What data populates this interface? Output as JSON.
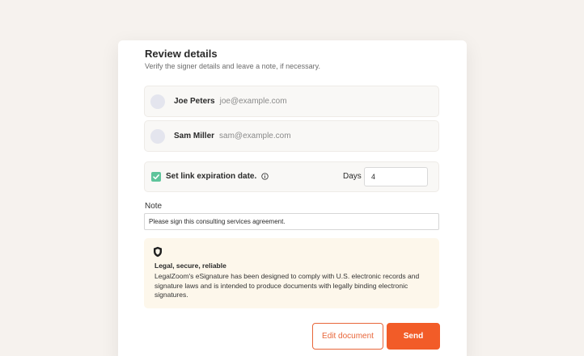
{
  "header": {
    "title": "Review details",
    "subtitle": "Verify the signer details and leave a note, if necessary."
  },
  "signers": [
    {
      "name": "Joe Peters",
      "email": "joe@example.com"
    },
    {
      "name": "Sam Miller",
      "email": "sam@example.com"
    }
  ],
  "expiration": {
    "label": "Set link expiration date.",
    "checked": true,
    "days_label": "Days",
    "days_value": "4"
  },
  "note": {
    "label": "Note",
    "value": "Please sign this consulting services agreement."
  },
  "callout": {
    "icon": "shield-icon",
    "title": "Legal, secure, reliable",
    "body": "LegalZoom's eSignature has been designed to comply with U.S. electronic records and signature laws and is intended to produce documents with legally binding electronic signatures."
  },
  "actions": {
    "edit_label": "Edit document",
    "send_label": "Send"
  },
  "colors": {
    "accent": "#f25c28",
    "checkbox": "#5ec49b",
    "callout_bg": "#fdf7eb"
  }
}
